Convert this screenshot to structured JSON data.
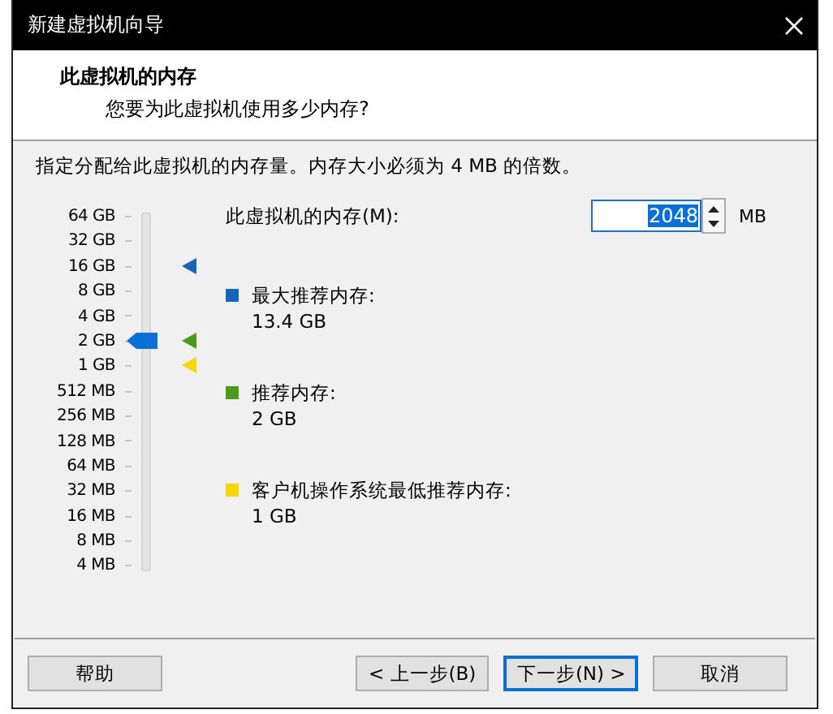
{
  "window": {
    "title": "新建虚拟机向导"
  },
  "header": {
    "title": "此虚拟机的内存",
    "subtitle": "您要为此虚拟机使用多少内存?"
  },
  "description": "指定分配给此虚拟机的内存量。内存大小必须为 4 MB 的倍数。",
  "memory_slider": {
    "ticks": [
      "64 GB",
      "32 GB",
      "16 GB",
      "8 GB",
      "4 GB",
      "2 GB",
      "1 GB",
      "512 MB",
      "256 MB",
      "128 MB",
      "64 MB",
      "32 MB",
      "16 MB",
      "8 MB",
      "4 MB"
    ],
    "level": 0.643
  },
  "memory_field": {
    "label": "此虚拟机的内存(M):",
    "value": "2048",
    "unit": "MB"
  },
  "legend": [
    {
      "color": "#1565b8",
      "label": "最大推荐内存:",
      "value": "13.4 GB",
      "level": 0.857
    },
    {
      "color": "#4c9a1c",
      "label": "推荐内存:",
      "value": "2 GB",
      "level": 0.643
    },
    {
      "color": "#f7d700",
      "label": "客户机操作系统最低推荐内存:",
      "value": "1 GB",
      "level": 0.571
    }
  ],
  "buttons": [
    {
      "label": "帮助",
      "focused": false
    },
    {
      "label": "< 上一步(B)",
      "focused": false
    },
    {
      "label": "下一步(N) >",
      "focused": true
    },
    {
      "label": "取消",
      "focused": false
    }
  ]
}
